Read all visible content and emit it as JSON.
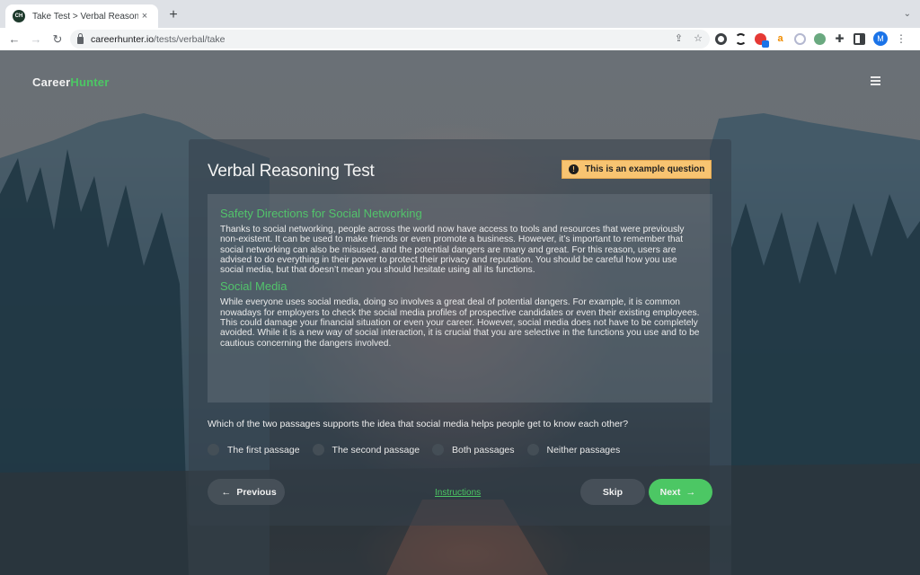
{
  "browser": {
    "tab": {
      "favicon_text": "CH",
      "title": "Take Test > Verbal Reasoning",
      "close_icon": "×"
    },
    "new_tab_icon": "+",
    "tab_search_icon": "⌄",
    "nav": {
      "back_icon": "←",
      "forward_icon": "→",
      "reload_icon": "↻"
    },
    "url": {
      "host": "careerhunter.io",
      "path": "/tests/verbal/take"
    },
    "omni_icons": {
      "share": "⇪",
      "bookmark": "☆"
    },
    "extensions": {
      "puzzle_icon": "✚",
      "amazon_letter": "a"
    },
    "profile_initial": "M",
    "menu_icon": "⋮"
  },
  "site": {
    "brand_part1": "Career",
    "brand_part2": "Hunter"
  },
  "test": {
    "title": "Verbal Reasoning Test",
    "badge_icon": "!",
    "badge_text": "This is an example question",
    "passages": [
      {
        "heading": "Safety Directions for Social Networking",
        "text": "Thanks to social networking, people across the world now have access to tools and resources that were previously non-existent. It can be used to make friends or even promote a business. However, it’s important to remember that social networking can also be misused, and the potential dangers are many and great. For this reason, users are advised to do everything in their power to protect their privacy and reputation. You should be careful how you use social media, but that doesn’t mean you should hesitate using all its functions."
      },
      {
        "heading": "Social Media",
        "text": "While everyone uses social media, doing so involves a great deal of potential dangers. For example, it is common nowadays for employers to check the social media profiles of prospective candidates or even their existing employees. This could damage your financial situation or even your career. However, social media does not have to be completely avoided. While it is a new way of social interaction, it is crucial that you are selective in the functions you use and to be cautious concerning the dangers involved."
      }
    ],
    "question": "Which of the two passages supports the idea that social media helps people get to know each other?",
    "options": [
      {
        "label": "The first passage",
        "selected": false
      },
      {
        "label": "The second passage",
        "selected": false
      },
      {
        "label": "Both passages",
        "selected": false
      },
      {
        "label": "Neither passages",
        "selected": false
      }
    ],
    "buttons": {
      "previous": "Previous",
      "previous_icon": "←",
      "instructions": "Instructions",
      "skip": "Skip",
      "next": "Next",
      "next_icon": "→"
    }
  },
  "colors": {
    "accent_green": "#4cc764",
    "badge_bg": "#f8c471"
  }
}
